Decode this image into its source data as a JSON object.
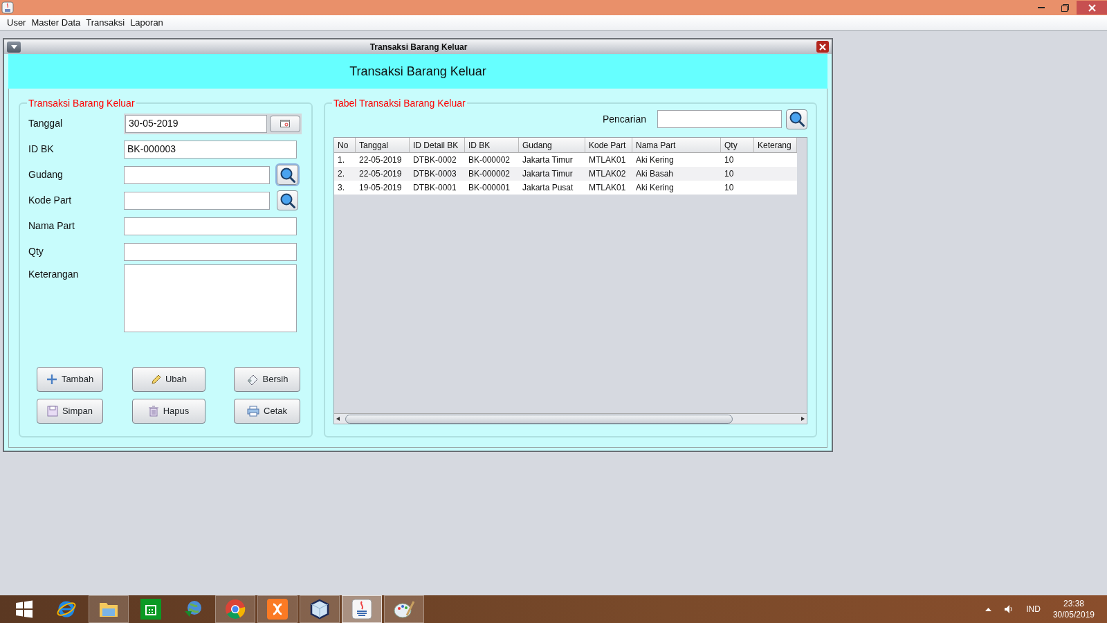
{
  "menu": [
    "User",
    "Master Data",
    "Transaksi",
    "Laporan"
  ],
  "frame": {
    "title": "Transaksi Barang Keluar",
    "header": "Transaksi Barang Keluar",
    "form": {
      "legend": "Transaksi Barang Keluar",
      "fields": [
        {
          "label": "Tanggal",
          "kind": "date",
          "value": "30-05-2019"
        },
        {
          "label": "ID BK",
          "kind": "text",
          "value": "BK-000003"
        },
        {
          "label": "Gudang",
          "kind": "lookup",
          "focused": true
        },
        {
          "label": "Kode Part",
          "kind": "lookup",
          "focused": false
        },
        {
          "label": "Nama Part",
          "kind": "text"
        },
        {
          "label": "Qty",
          "kind": "text"
        },
        {
          "label": "Keterangan",
          "kind": "textarea"
        }
      ],
      "buttons": [
        "Tambah",
        "Ubah",
        "Bersih",
        "Simpan",
        "Hapus",
        "Cetak"
      ]
    },
    "table": {
      "legend": "Tabel Transaksi Barang Keluar",
      "search_label": "Pencarian",
      "columns": [
        "No",
        "Tanggal",
        "ID Detail BK",
        "ID BK",
        "Gudang",
        "Kode Part",
        "Nama Part",
        "Qty",
        "Keterang"
      ],
      "rows": [
        [
          "1.",
          "22-05-2019",
          "DTBK-0002",
          "BK-000002",
          "Jakarta Timur",
          "MTLAK01",
          "Aki Kering",
          "10"
        ],
        [
          "2.",
          "22-05-2019",
          "DTBK-0003",
          "BK-000002",
          "Jakarta Timur",
          "MTLAK02",
          "Aki Basah",
          "10"
        ],
        [
          "3.",
          "19-05-2019",
          "DTBK-0001",
          "BK-000001",
          "Jakarta Pusat",
          "MTLAK01",
          "Aki Kering",
          "10"
        ]
      ]
    }
  },
  "taskbar": {
    "apps": [
      {
        "running": false,
        "selected": false
      },
      {
        "running": true,
        "selected": false
      },
      {
        "running": false,
        "selected": false
      },
      {
        "running": false,
        "selected": false
      },
      {
        "running": true,
        "selected": false
      },
      {
        "running": true,
        "selected": false
      },
      {
        "running": true,
        "selected": false
      },
      {
        "running": true,
        "selected": true
      },
      {
        "running": true,
        "selected": false
      }
    ],
    "language": "IND",
    "time": "23:38",
    "date": "30/05/2019"
  }
}
